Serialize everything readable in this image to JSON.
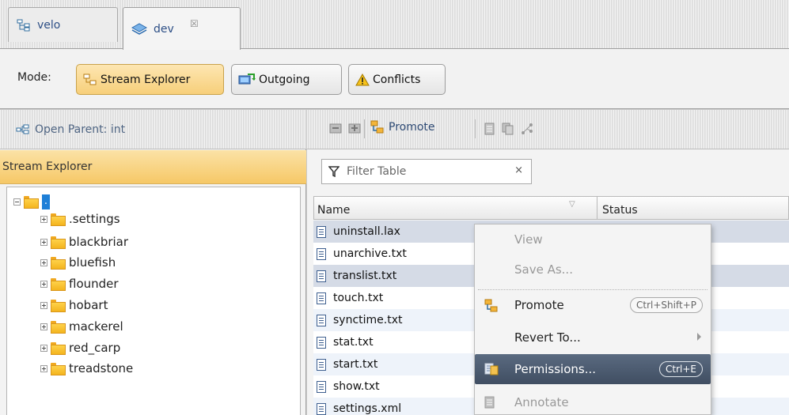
{
  "tabs": [
    {
      "label": "velo",
      "icon": "stream-tree-icon"
    },
    {
      "label": "dev",
      "icon": "workspace-icon",
      "close": "☒"
    }
  ],
  "mode": {
    "label": "Mode:",
    "buttons": [
      {
        "label": "Stream Explorer",
        "icon": "stream-explorer-icon",
        "active": true
      },
      {
        "label": "Outgoing",
        "icon": "outgoing-icon"
      },
      {
        "label": "Conflicts",
        "icon": "warning-icon"
      }
    ]
  },
  "left_panel": {
    "open_parent": "Open Parent:  int",
    "explorer_title": "Stream Explorer",
    "tree": {
      "root_label": ".",
      "children": [
        ".settings",
        "blackbriar",
        "bluefish",
        "flounder",
        "hobart",
        "mackerel",
        "red_carp",
        "treadstone"
      ]
    }
  },
  "right_panel": {
    "toolbar": {
      "promote_label": "Promote"
    },
    "filter_placeholder": "Filter Table",
    "filter_clear": "×",
    "columns": {
      "name": "Name",
      "status": "Status",
      "sort_glyph": "▽"
    },
    "files": [
      "uninstall.lax",
      "unarchive.txt",
      "translist.txt",
      "touch.txt",
      "synctime.txt",
      "stat.txt",
      "start.txt",
      "show.txt",
      "settings.xml"
    ]
  },
  "context_menu": {
    "view": "View",
    "save_as": "Save As...",
    "promote": "Promote",
    "promote_shortcut": "Ctrl+Shift+P",
    "revert_to": "Revert To...",
    "permissions": "Permissions...",
    "permissions_shortcut": "Ctrl+E",
    "annotate": "Annotate"
  },
  "colors": {
    "accent_orange": "#f6c867",
    "selected_row": "#d5dbe6",
    "menu_highlight": "#4a5870"
  }
}
